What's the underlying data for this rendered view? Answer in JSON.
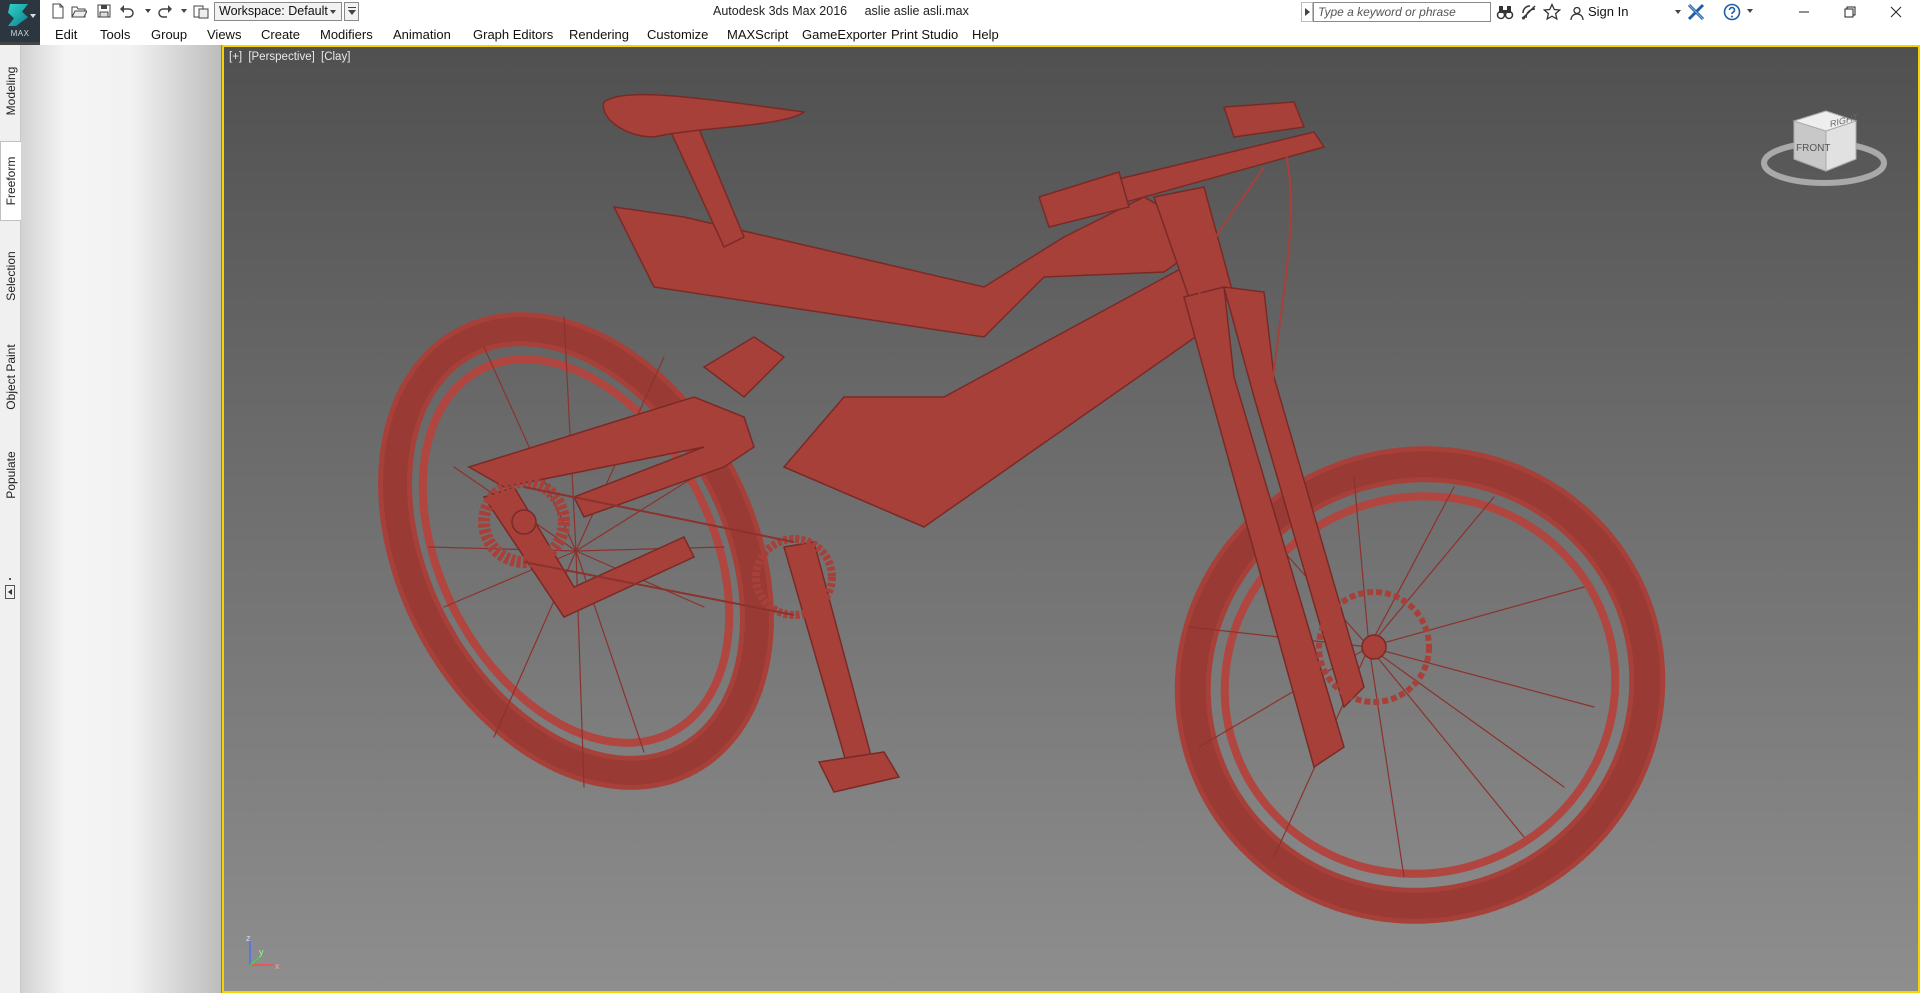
{
  "app": {
    "logo_label": "MAX",
    "title": "Autodesk 3ds Max 2016",
    "file_name": "aslie aslie asli.max"
  },
  "toolbar": {
    "workspace_label": "Workspace: Default"
  },
  "search": {
    "placeholder": "Type a keyword or phrase"
  },
  "account": {
    "sign_in_label": "Sign In"
  },
  "menu": [
    "Edit",
    "Tools",
    "Group",
    "Views",
    "Create",
    "Modifiers",
    "Animation",
    "Graph Editors",
    "Rendering",
    "Customize",
    "MAXScript",
    "GameExporter",
    "Print Studio",
    "Help"
  ],
  "ribbon": {
    "tabs": [
      "Modeling",
      "Freeform",
      "Selection",
      "Object Paint",
      "Populate"
    ],
    "active_tab": "Freeform"
  },
  "viewport": {
    "label_parts": [
      "[+]",
      "[Perspective]",
      "[Clay]"
    ],
    "viewcube_face": "FRONT",
    "viewcube_right_face": "RIGHT",
    "axis_labels": {
      "x": "x",
      "y": "y",
      "z": "z"
    },
    "model_color": "#a8403a",
    "border_color": "#f5d300"
  }
}
